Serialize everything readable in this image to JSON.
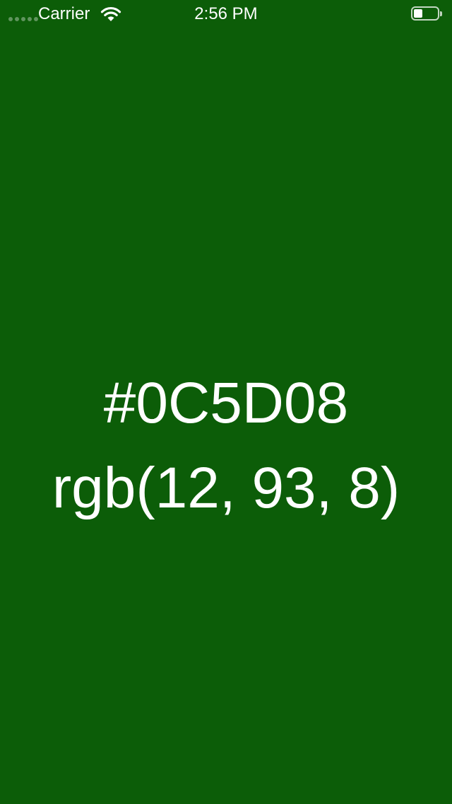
{
  "status_bar": {
    "carrier": "Carrier",
    "time": "2:56 PM",
    "signal_icon": "signal-dots-icon",
    "wifi_icon": "wifi-icon",
    "battery_icon": "battery-icon",
    "battery_level": 0.3
  },
  "color": {
    "hex": "#0C5D08",
    "rgb": "rgb(12, 93, 8)",
    "background": "#0C5D08"
  }
}
